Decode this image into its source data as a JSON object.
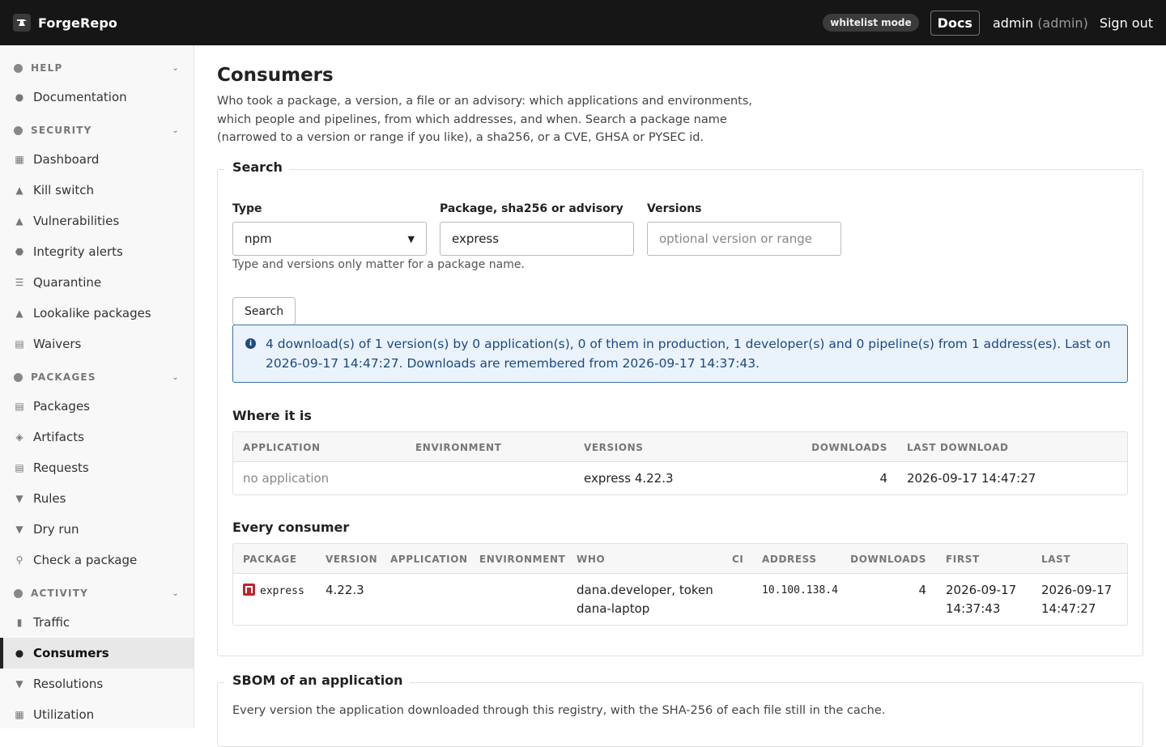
{
  "header": {
    "app_name": "ForgeRepo",
    "mode_badge": "whitelist mode",
    "docs_label": "Docs",
    "user_name": "admin",
    "user_role": "(admin)",
    "signout_label": "Sign out"
  },
  "sidebar": {
    "groups": [
      {
        "label": "HELP",
        "icon": "info-icon"
      },
      {
        "label": "SECURITY",
        "icon": "shield-icon"
      },
      {
        "label": "PACKAGES",
        "icon": "box-icon"
      },
      {
        "label": "ACTIVITY",
        "icon": "clock-icon"
      }
    ],
    "items": [
      {
        "label": "Documentation",
        "icon": "info-icon"
      },
      {
        "label": "Dashboard",
        "icon": "grid-icon"
      },
      {
        "label": "Kill switch",
        "icon": "warning-icon"
      },
      {
        "label": "Vulnerabilities",
        "icon": "warning-icon"
      },
      {
        "label": "Integrity alerts",
        "icon": "shield-icon"
      },
      {
        "label": "Quarantine",
        "icon": "list-icon"
      },
      {
        "label": "Lookalike packages",
        "icon": "warning-icon"
      },
      {
        "label": "Waivers",
        "icon": "document-icon"
      },
      {
        "label": "Packages",
        "icon": "archive-icon"
      },
      {
        "label": "Artifacts",
        "icon": "layers-icon"
      },
      {
        "label": "Requests",
        "icon": "document-icon"
      },
      {
        "label": "Rules",
        "icon": "filter-icon"
      },
      {
        "label": "Dry run",
        "icon": "filter-icon"
      },
      {
        "label": "Check a package",
        "icon": "search-icon"
      },
      {
        "label": "Traffic",
        "icon": "bars-icon"
      },
      {
        "label": "Consumers",
        "icon": "person-icon",
        "active": true
      },
      {
        "label": "Resolutions",
        "icon": "filter-icon"
      },
      {
        "label": "Utilization",
        "icon": "grid-icon"
      }
    ]
  },
  "main": {
    "title": "Consumers",
    "intro": "Who took a package, a version, a file or an advisory: which applications and environments, which people and pipelines, from which addresses, and when. Search a package name (narrowed to a version or range if you like), a sha256, or a CVE, GHSA or PYSEC id.",
    "search": {
      "legend": "Search",
      "type_label": "Type",
      "type_value": "npm",
      "query_label": "Package, sha256 or advisory",
      "query_value": "express",
      "versions_label": "Versions",
      "versions_placeholder": "optional version or range",
      "help": "Type and versions only matter for a package name.",
      "button": "Search"
    },
    "alert": "4 download(s) of 1 version(s) by 0 application(s), 0 of them in production, 1 developer(s) and 0 pipeline(s) from 1 address(es). Last on 2026-09-17 14:47:27. Downloads are remembered from 2026-09-17 14:37:43.",
    "where": {
      "title": "Where it is",
      "columns": [
        "APPLICATION",
        "ENVIRONMENT",
        "VERSIONS",
        "DOWNLOADS",
        "LAST DOWNLOAD"
      ],
      "rows": [
        {
          "application": "no application",
          "environment": "",
          "versions": "express 4.22.3",
          "downloads": "4",
          "last": "2026-09-17 14:47:27"
        }
      ]
    },
    "consumers": {
      "title": "Every consumer",
      "columns": [
        "PACKAGE",
        "VERSION",
        "APPLICATION",
        "ENVIRONMENT",
        "WHO",
        "CI",
        "ADDRESS",
        "DOWNLOADS",
        "FIRST",
        "LAST"
      ],
      "rows": [
        {
          "package": "express",
          "version": "4.22.3",
          "application": "",
          "environment": "",
          "who_line1": "dana.developer, token",
          "who_line2": "dana-laptop",
          "ci": "",
          "address": "10.100.138.4",
          "downloads": "4",
          "first_date": "2026-09-17",
          "first_time": "14:37:43",
          "last_date": "2026-09-17",
          "last_time": "14:47:27"
        }
      ]
    },
    "sbom": {
      "legend": "SBOM of an application",
      "description": "Every version the application downloaded through this registry, with the SHA-256 of each file still in the cache."
    }
  }
}
